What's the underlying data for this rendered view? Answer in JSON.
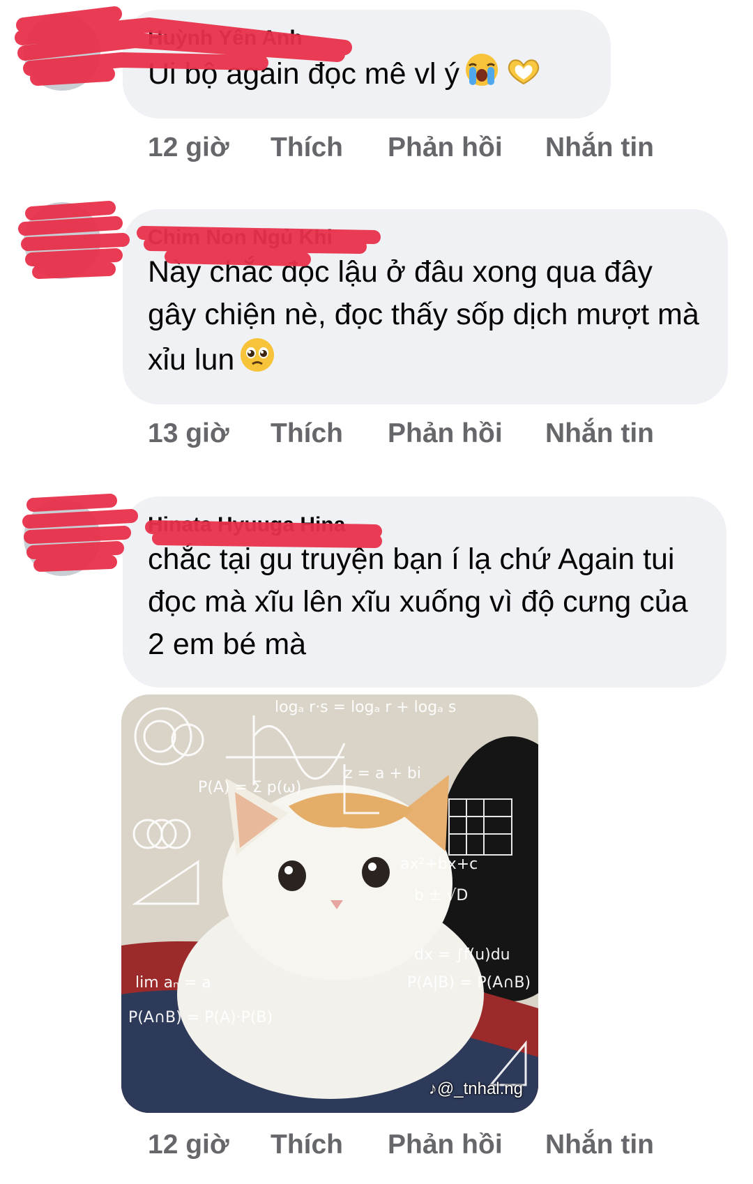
{
  "comments": [
    {
      "author": "Huỳnh Yên Anh",
      "text": "Ui bộ again đọc mê vl ý",
      "emojis": [
        "loudly-crying-face",
        "heart-hands"
      ],
      "time": "12 giờ",
      "like": "Thích",
      "reply": "Phản hồi",
      "message": "Nhắn tin"
    },
    {
      "author": "Chim Non Ngủ Khi",
      "text": "Này chắc đọc lậu ở đâu xong qua đây gây chiện nè, đọc thấy sốp dịch mượt mà xỉu lun",
      "emojis": [
        "pleading-face"
      ],
      "time": "13 giờ",
      "like": "Thích",
      "reply": "Phản hồi",
      "message": "Nhắn tin"
    },
    {
      "author": "Hinata Hyuuga Hina",
      "text": "chắc tại gu truyện bạn í lạ chứ Again tui đọc mà xĩu lên xĩu xuống vì độ cưng của 2 em bé mà",
      "time": "12 giờ",
      "like": "Thích",
      "reply": "Phản hồi",
      "message": "Nhắn tin",
      "attachment": {
        "type": "image",
        "subject": "confused-cat-math-meme",
        "credit": "♪@_tnhal.ng"
      }
    }
  ],
  "colors": {
    "bubble": "#eff1f4",
    "action_text": "#65676b",
    "redaction": "#e8304a"
  }
}
